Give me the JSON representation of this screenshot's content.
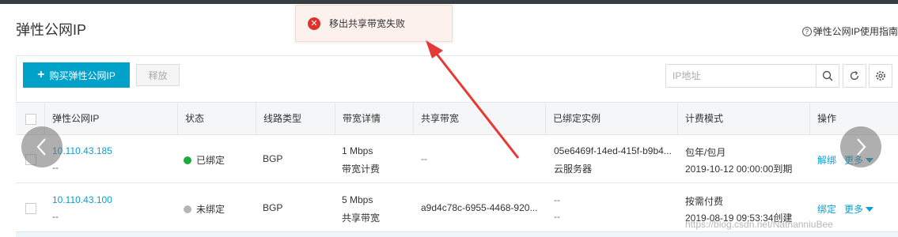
{
  "header": {
    "title": "弹性公网IP",
    "help_label": "弹性公网IP使用指南",
    "help_icon_glyph": "?"
  },
  "toolbar": {
    "buy_label": "购买弹性公网IP",
    "buy_icon": "plus-icon",
    "release_label": "释放",
    "search_placeholder": "IP地址",
    "search_icon": "search-icon",
    "refresh_icon": "refresh-icon",
    "settings_icon": "gear-icon"
  },
  "table": {
    "columns": [
      "弹性公网IP",
      "状态",
      "线路类型",
      "带宽详情",
      "共享带宽",
      "已绑定实例",
      "计费模式",
      "操作"
    ],
    "rows": [
      {
        "ip": "10.110.43.185",
        "ip_sub": "--",
        "status": "已绑定",
        "status_color": "#1eaa3d",
        "line": "BGP",
        "bandwidth": "1 Mbps",
        "bandwidth_sub": "带宽计费",
        "shared": "--",
        "instance": "05e6469f-14ed-415f-b9b4...",
        "instance_sub": "云服务器",
        "billing": "包年/包月",
        "billing_sub": "2019-10-12 00:00:00到期",
        "action1": "解绑",
        "action2": "更多"
      },
      {
        "ip": "10.110.43.100",
        "ip_sub": "--",
        "status": "未绑定",
        "status_color": "#b5b5b5",
        "line": "BGP",
        "bandwidth": "5 Mbps",
        "bandwidth_sub": "共享带宽",
        "shared": "a9d4c78c-6955-4468-920...",
        "instance": "--",
        "instance_sub": "--",
        "billing": "按需付费",
        "billing_sub": "2019-08-19 09:53:34创建",
        "action1": "绑定",
        "action2": "更多"
      }
    ]
  },
  "toast": {
    "message": "移出共享带宽失败",
    "icon": "error-icon",
    "icon_glyph": "✕",
    "color": "#e0322a"
  },
  "watermark": "https://blog.csdn.net/NathanniuBee",
  "colors": {
    "accent": "#00a2ca",
    "link": "#0aa0d2",
    "annotation_arrow": "#e53935"
  }
}
